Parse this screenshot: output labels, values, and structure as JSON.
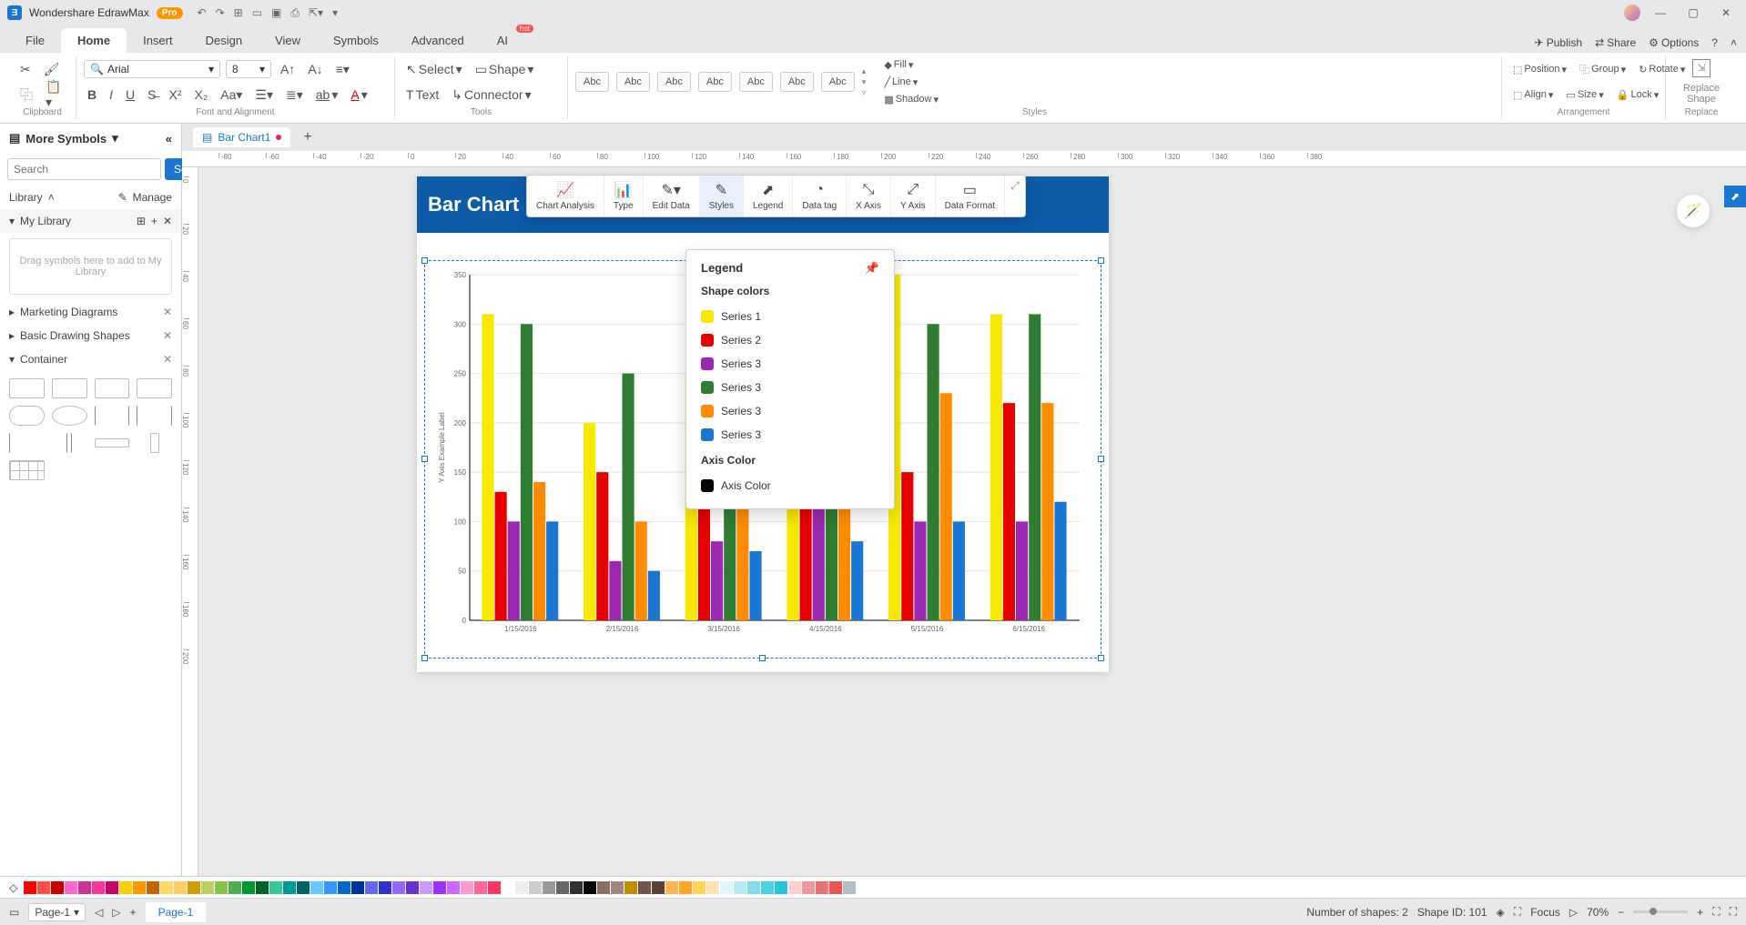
{
  "app": {
    "name": "Wondershare EdrawMax",
    "badge": "Pro"
  },
  "window": {
    "min": "—",
    "max": "▢",
    "close": "✕"
  },
  "menu": {
    "tabs": [
      "File",
      "Home",
      "Insert",
      "Design",
      "View",
      "Symbols",
      "Advanced",
      "AI"
    ],
    "active": 1,
    "hot": "hot",
    "right": {
      "publish": "Publish",
      "share": "Share",
      "options": "Options"
    }
  },
  "ribbon": {
    "font_name": "Arial",
    "font_size": "8",
    "select": "Select",
    "shape": "Shape",
    "text": "Text",
    "connector": "Connector",
    "fill": "Fill",
    "line": "Line",
    "shadow": "Shadow",
    "position": "Position",
    "group": "Group",
    "rotate": "Rotate",
    "align": "Align",
    "size": "Size",
    "lock": "Lock",
    "replace_shape": "Replace Shape",
    "groups": {
      "clipboard": "Clipboard",
      "font": "Font and Alignment",
      "tools": "Tools",
      "styles": "Styles",
      "arr": "Arrangement",
      "repl": "Replace"
    },
    "style_label": "Abc"
  },
  "sidebar": {
    "header": "More Symbols",
    "search_ph": "Search",
    "search_btn": "Search",
    "library_lbl": "Library",
    "manage": "Manage",
    "mylib": "My Library",
    "drop_hint": "Drag symbols here to add to My Library",
    "sections": [
      {
        "label": "Marketing Diagrams"
      },
      {
        "label": "Basic Drawing Shapes"
      },
      {
        "label": "Container"
      }
    ]
  },
  "doc": {
    "tab": "Bar Chart1"
  },
  "ruler_h": [
    "-80",
    "-60",
    "-40",
    "-20",
    "0",
    "20",
    "40",
    "60",
    "80",
    "100",
    "120",
    "140",
    "160",
    "180",
    "200",
    "220",
    "240",
    "260",
    "280",
    "300",
    "320",
    "340",
    "360",
    "380"
  ],
  "ruler_v": [
    "0",
    "20",
    "40",
    "60",
    "80",
    "100",
    "120",
    "140",
    "160",
    "180",
    "200"
  ],
  "page": {
    "title": "Bar Chart"
  },
  "float_tb": [
    "Chart Analysis",
    "Type",
    "Edit Data",
    "Styles",
    "Legend",
    "Data tag",
    "X Axis",
    "Y Axis",
    "Data Format"
  ],
  "legend_panel": {
    "title": "Legend",
    "shape_colors": "Shape colors",
    "axis_color_hdr": "Axis Color",
    "axis_color_lbl": "Axis Color",
    "items": [
      {
        "label": "Series 1",
        "color": "#f9e800"
      },
      {
        "label": "Series 2",
        "color": "#e60000"
      },
      {
        "label": "Series 3",
        "color": "#9c27b0"
      },
      {
        "label": "Series 3",
        "color": "#2e7d32"
      },
      {
        "label": "Series 3",
        "color": "#ff8c00"
      },
      {
        "label": "Series 3",
        "color": "#1976d2"
      }
    ]
  },
  "color_swatches": [
    "#ff0000",
    "#ff4d4d",
    "#cc0000",
    "#ff66cc",
    "#cc3399",
    "#ff3399",
    "#cc0066",
    "#ffcc00",
    "#ff9900",
    "#cc6600",
    "#ffd966",
    "#ffcc66",
    "#d1a000",
    "#c0d060",
    "#8bc34a",
    "#4caf50",
    "#009933",
    "#006622",
    "#33cc99",
    "#009999",
    "#006666",
    "#66ccff",
    "#3399ff",
    "#0066cc",
    "#003399",
    "#6666ff",
    "#3333cc",
    "#9966ff",
    "#6633cc",
    "#cc99ff",
    "#9933ff",
    "#cc66ff",
    "#ff99cc",
    "#ff6699",
    "#ff3366",
    "#ffffff",
    "#eeeeee",
    "#cccccc",
    "#999999",
    "#666666",
    "#333333",
    "#000000",
    "#8d6e63",
    "#a1887f",
    "#bf8f00",
    "#795548",
    "#5d4037",
    "#ffb74d",
    "#ffa726",
    "#ffd54f",
    "#ffe0b2",
    "#e0f7fa",
    "#b2ebf2",
    "#80deea",
    "#4dd0e1",
    "#26c6da",
    "#ffcdd2",
    "#ef9a9a",
    "#e57373",
    "#ef5350",
    "#b0bec5"
  ],
  "status": {
    "page_sel": "Page-1",
    "page_tab": "Page-1",
    "shape_count": "Number of shapes: 2",
    "shape_id": "Shape ID: 101",
    "focus": "Focus",
    "zoom": "70%"
  },
  "chart_data": {
    "type": "bar",
    "title": "Bar Chart",
    "ylabel": "Y Axis Example Label",
    "ylim": [
      0,
      350
    ],
    "categories": [
      "1/15/2016",
      "2/15/2016",
      "3/15/2016",
      "4/15/2016",
      "5/15/2016",
      "6/15/2016"
    ],
    "series": [
      {
        "name": "Series 1",
        "color": "#f9e800",
        "values": [
          310,
          200,
          250,
          260,
          350,
          310
        ]
      },
      {
        "name": "Series 2",
        "color": "#e60000",
        "values": [
          130,
          150,
          170,
          190,
          150,
          220
        ]
      },
      {
        "name": "Series 3",
        "color": "#9c27b0",
        "values": [
          100,
          60,
          80,
          150,
          100,
          100
        ]
      },
      {
        "name": "Series 3",
        "color": "#2e7d32",
        "values": [
          300,
          250,
          280,
          300,
          300,
          310
        ]
      },
      {
        "name": "Series 3",
        "color": "#ff8c00",
        "values": [
          140,
          100,
          120,
          350,
          230,
          220
        ]
      },
      {
        "name": "Series 3",
        "color": "#1976d2",
        "values": [
          100,
          50,
          70,
          80,
          100,
          120
        ]
      }
    ],
    "yticks": [
      0,
      50,
      100,
      150,
      200,
      250,
      300,
      350
    ]
  }
}
